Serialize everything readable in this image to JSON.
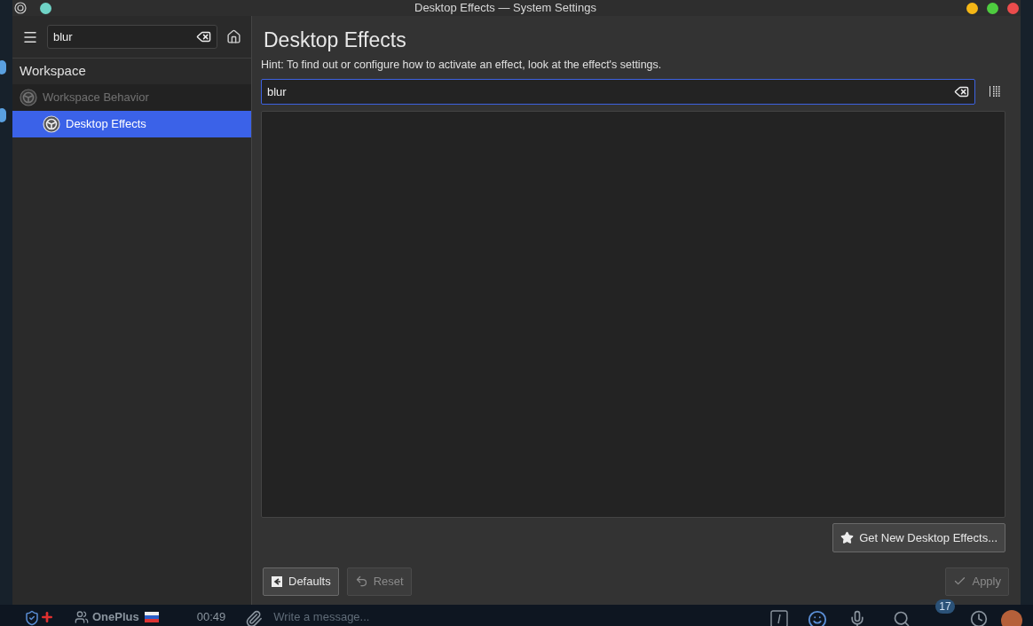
{
  "window": {
    "title": "Desktop Effects — System Settings"
  },
  "sidebar": {
    "search": {
      "value": "blur"
    },
    "category": "Workspace",
    "items": [
      {
        "label": "Workspace Behavior",
        "disabled": true,
        "selected": false,
        "children": [
          {
            "label": "Desktop Effects",
            "disabled": false,
            "selected": true
          }
        ]
      }
    ]
  },
  "page": {
    "title": "Desktop Effects",
    "hint": "Hint: To find out or configure how to activate an effect, look at the effect's settings.",
    "filter": {
      "value": "blur"
    },
    "get_new_button": "Get New Desktop Effects...",
    "buttons": [
      {
        "kind": "defaults",
        "label": "Defaults",
        "disabled": false
      },
      {
        "kind": "reset",
        "label": "Reset",
        "disabled": true
      },
      {
        "kind": "apply",
        "label": "Apply",
        "disabled": true
      }
    ]
  },
  "background_app": {
    "chat_name": "OnePlus",
    "time": "00:49",
    "message_placeholder": "Write a message...",
    "badge": "17"
  }
}
